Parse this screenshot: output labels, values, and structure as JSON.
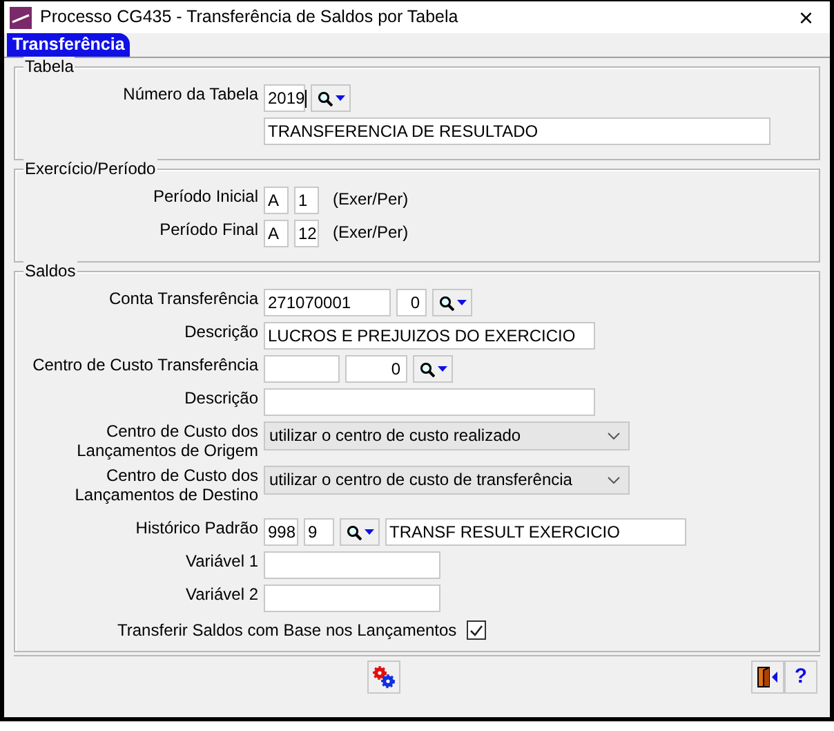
{
  "window": {
    "title": "Processo CG435 - Transferência de Saldos por Tabela",
    "close": "×"
  },
  "tabs": [
    {
      "label": "Transferência",
      "selected": true
    }
  ],
  "groups": [
    {
      "title": "Tabela",
      "rows": [
        {
          "label": "Número da Tabela",
          "fields": [
            {
              "kind": "input",
              "value": "2019",
              "focused": true
            },
            {
              "kind": "lookup"
            }
          ]
        },
        {
          "fields": [
            {
              "kind": "input",
              "value": "TRANSFERENCIA DE RESULTADO"
            }
          ]
        }
      ]
    },
    {
      "title": "Exercício/Período",
      "rows": [
        {
          "label": "Período Inicial",
          "fields": [
            {
              "kind": "input",
              "value": "A"
            },
            {
              "kind": "input",
              "value": "1"
            },
            {
              "kind": "note",
              "value": "(Exer/Per)"
            }
          ]
        },
        {
          "label": "Período Final",
          "fields": [
            {
              "kind": "input",
              "value": "A"
            },
            {
              "kind": "input",
              "value": "12"
            },
            {
              "kind": "note",
              "value": "(Exer/Per)"
            }
          ]
        }
      ]
    },
    {
      "title": "Saldos",
      "rows": [
        {
          "label": "Conta Transferência",
          "fields": [
            {
              "kind": "input",
              "value": "271070001"
            },
            {
              "kind": "input",
              "value": "0"
            },
            {
              "kind": "lookup"
            }
          ]
        },
        {
          "label": "Descrição",
          "fields": [
            {
              "kind": "input",
              "value": "LUCROS E PREJUIZOS DO EXERCICIO"
            }
          ]
        },
        {
          "label": "Centro de Custo Transferência",
          "fields": [
            {
              "kind": "input"
            },
            {
              "kind": "input",
              "value": "0"
            },
            {
              "kind": "lookup"
            }
          ]
        },
        {
          "label": "Descrição",
          "fields": [
            {
              "kind": "input"
            }
          ]
        },
        {
          "label": "Centro de Custo dos Lançamentos de Origem",
          "fields": [
            {
              "kind": "select",
              "value": "utilizar o centro de custo realizado"
            }
          ]
        },
        {
          "label": "Centro de Custo dos Lançamentos de Destino",
          "fields": [
            {
              "kind": "select",
              "value": "utilizar o centro de custo de transferência"
            }
          ]
        },
        {
          "label": "Histórico Padrão",
          "fields": [
            {
              "kind": "input",
              "value": "998"
            },
            {
              "kind": "input",
              "value": "9"
            },
            {
              "kind": "lookup"
            },
            {
              "kind": "input",
              "value": "TRANSF RESULT EXERCICIO"
            }
          ]
        },
        {
          "label": "Variável 1",
          "fields": [
            {
              "kind": "input"
            }
          ]
        },
        {
          "label": "Variável 2",
          "fields": [
            {
              "kind": "input"
            }
          ]
        },
        {
          "kind": "checkbox",
          "label": "Transferir Saldos com Base nos Lançamentos",
          "checked": true
        }
      ]
    }
  ],
  "buttons": [
    {
      "kind": "run"
    },
    {
      "kind": "exit"
    },
    {
      "kind": "help",
      "label": "?"
    }
  ]
}
